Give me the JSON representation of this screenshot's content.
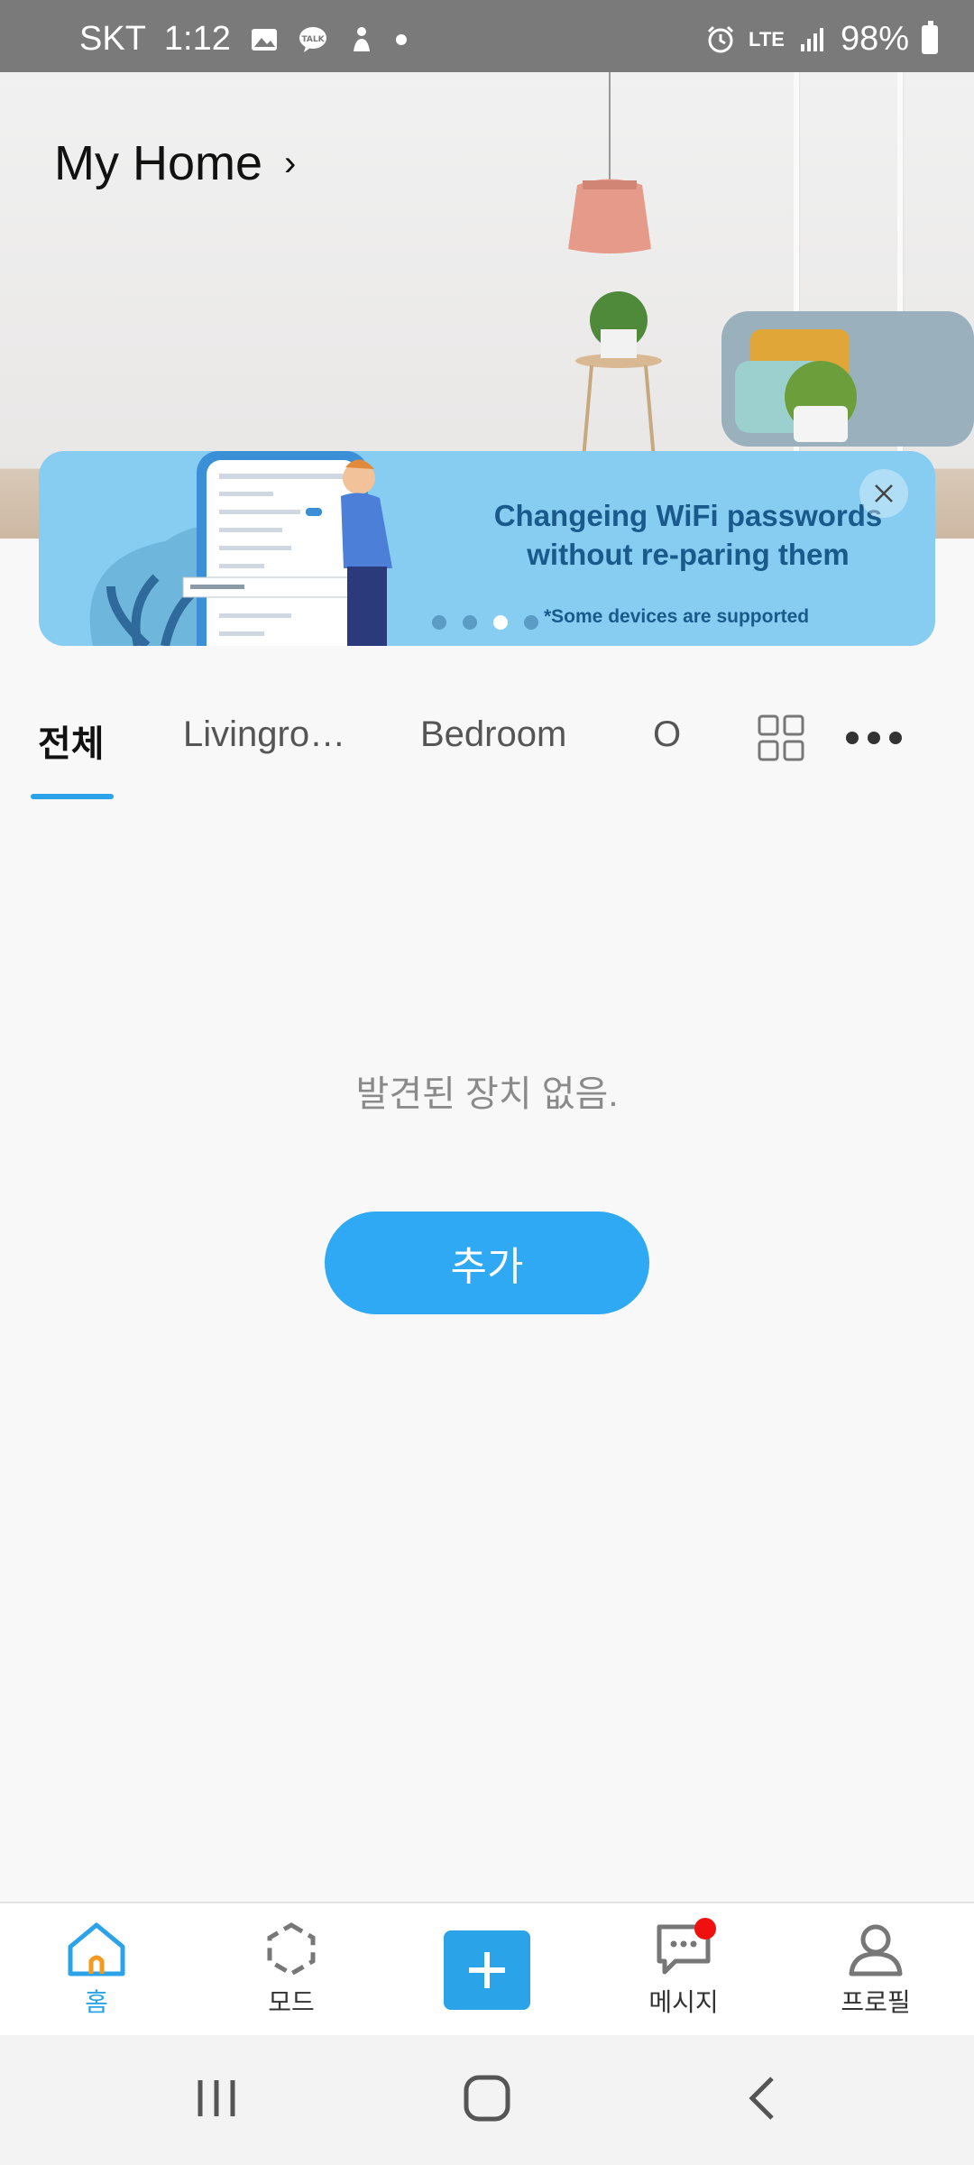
{
  "status_bar": {
    "carrier": "SKT",
    "time": "1:12",
    "network": "LTE",
    "battery": "98%",
    "left_icons": [
      "gallery-icon",
      "kakaotalk-icon",
      "app-icon",
      "dot-icon"
    ],
    "right_icons": [
      "alarm-icon",
      "lte-icon",
      "signal-icon",
      "battery-icon"
    ]
  },
  "header": {
    "title": "My Home",
    "chevron": "›"
  },
  "banner": {
    "title": "Changeing WiFi passwords without re-paring them",
    "subtitle": "*Some devices are supported",
    "page_count": 4,
    "active_page": 3
  },
  "tabs": {
    "items": [
      {
        "label": "전체",
        "active": true
      },
      {
        "label": "Livingro…",
        "active": false
      },
      {
        "label": "Bedroom",
        "active": false
      },
      {
        "label": "O",
        "active": false
      }
    ]
  },
  "main": {
    "empty_message": "발견된 장치 없음.",
    "add_button": "추가"
  },
  "bottom_nav": {
    "items": [
      {
        "label": "홈",
        "icon": "home-icon",
        "active": true
      },
      {
        "label": "모드",
        "icon": "mode-icon",
        "active": false
      },
      {
        "label": "",
        "icon": "plus-icon",
        "active": false
      },
      {
        "label": "메시지",
        "icon": "message-icon",
        "active": false,
        "badge": true
      },
      {
        "label": "프로필",
        "icon": "profile-icon",
        "active": false
      }
    ]
  },
  "colors": {
    "accent": "#2aa3e8",
    "button": "#2fa9f3",
    "banner": "#86cdf1",
    "badge": "#f01010"
  }
}
